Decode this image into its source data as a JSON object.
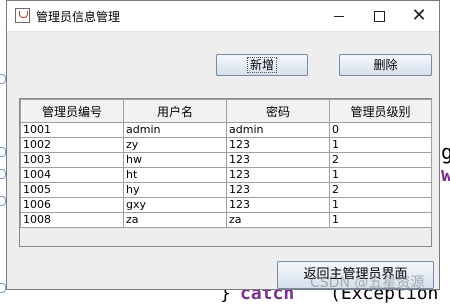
{
  "window": {
    "title": "管理员信息管理"
  },
  "toolbar": {
    "add_label": "新增",
    "delete_label": "删除"
  },
  "table": {
    "columns": [
      "管理员编号",
      "用户名",
      "密码",
      "管理员级别"
    ],
    "rows": [
      [
        "1001",
        "admin",
        "admin",
        "0"
      ],
      [
        "1002",
        "zy",
        "123",
        "1"
      ],
      [
        "1003",
        "hw",
        "123",
        "2"
      ],
      [
        "1004",
        "ht",
        "123",
        "1"
      ],
      [
        "1005",
        "hy",
        "123",
        "2"
      ],
      [
        "1006",
        "gxy",
        "123",
        "1"
      ],
      [
        "1008",
        "za",
        "za",
        "1"
      ]
    ]
  },
  "footer": {
    "back_label": "返回主管理员界面"
  },
  "background": {
    "code_g": "g",
    "code_w": "w",
    "code_catch": "catch",
    "code_exception": "(Exception",
    "code_brace": "}",
    "watermark": "CSDN @五星资源"
  },
  "colors": {
    "accent_code": "#7b2d8e",
    "window_bg": "#eeeeee"
  }
}
